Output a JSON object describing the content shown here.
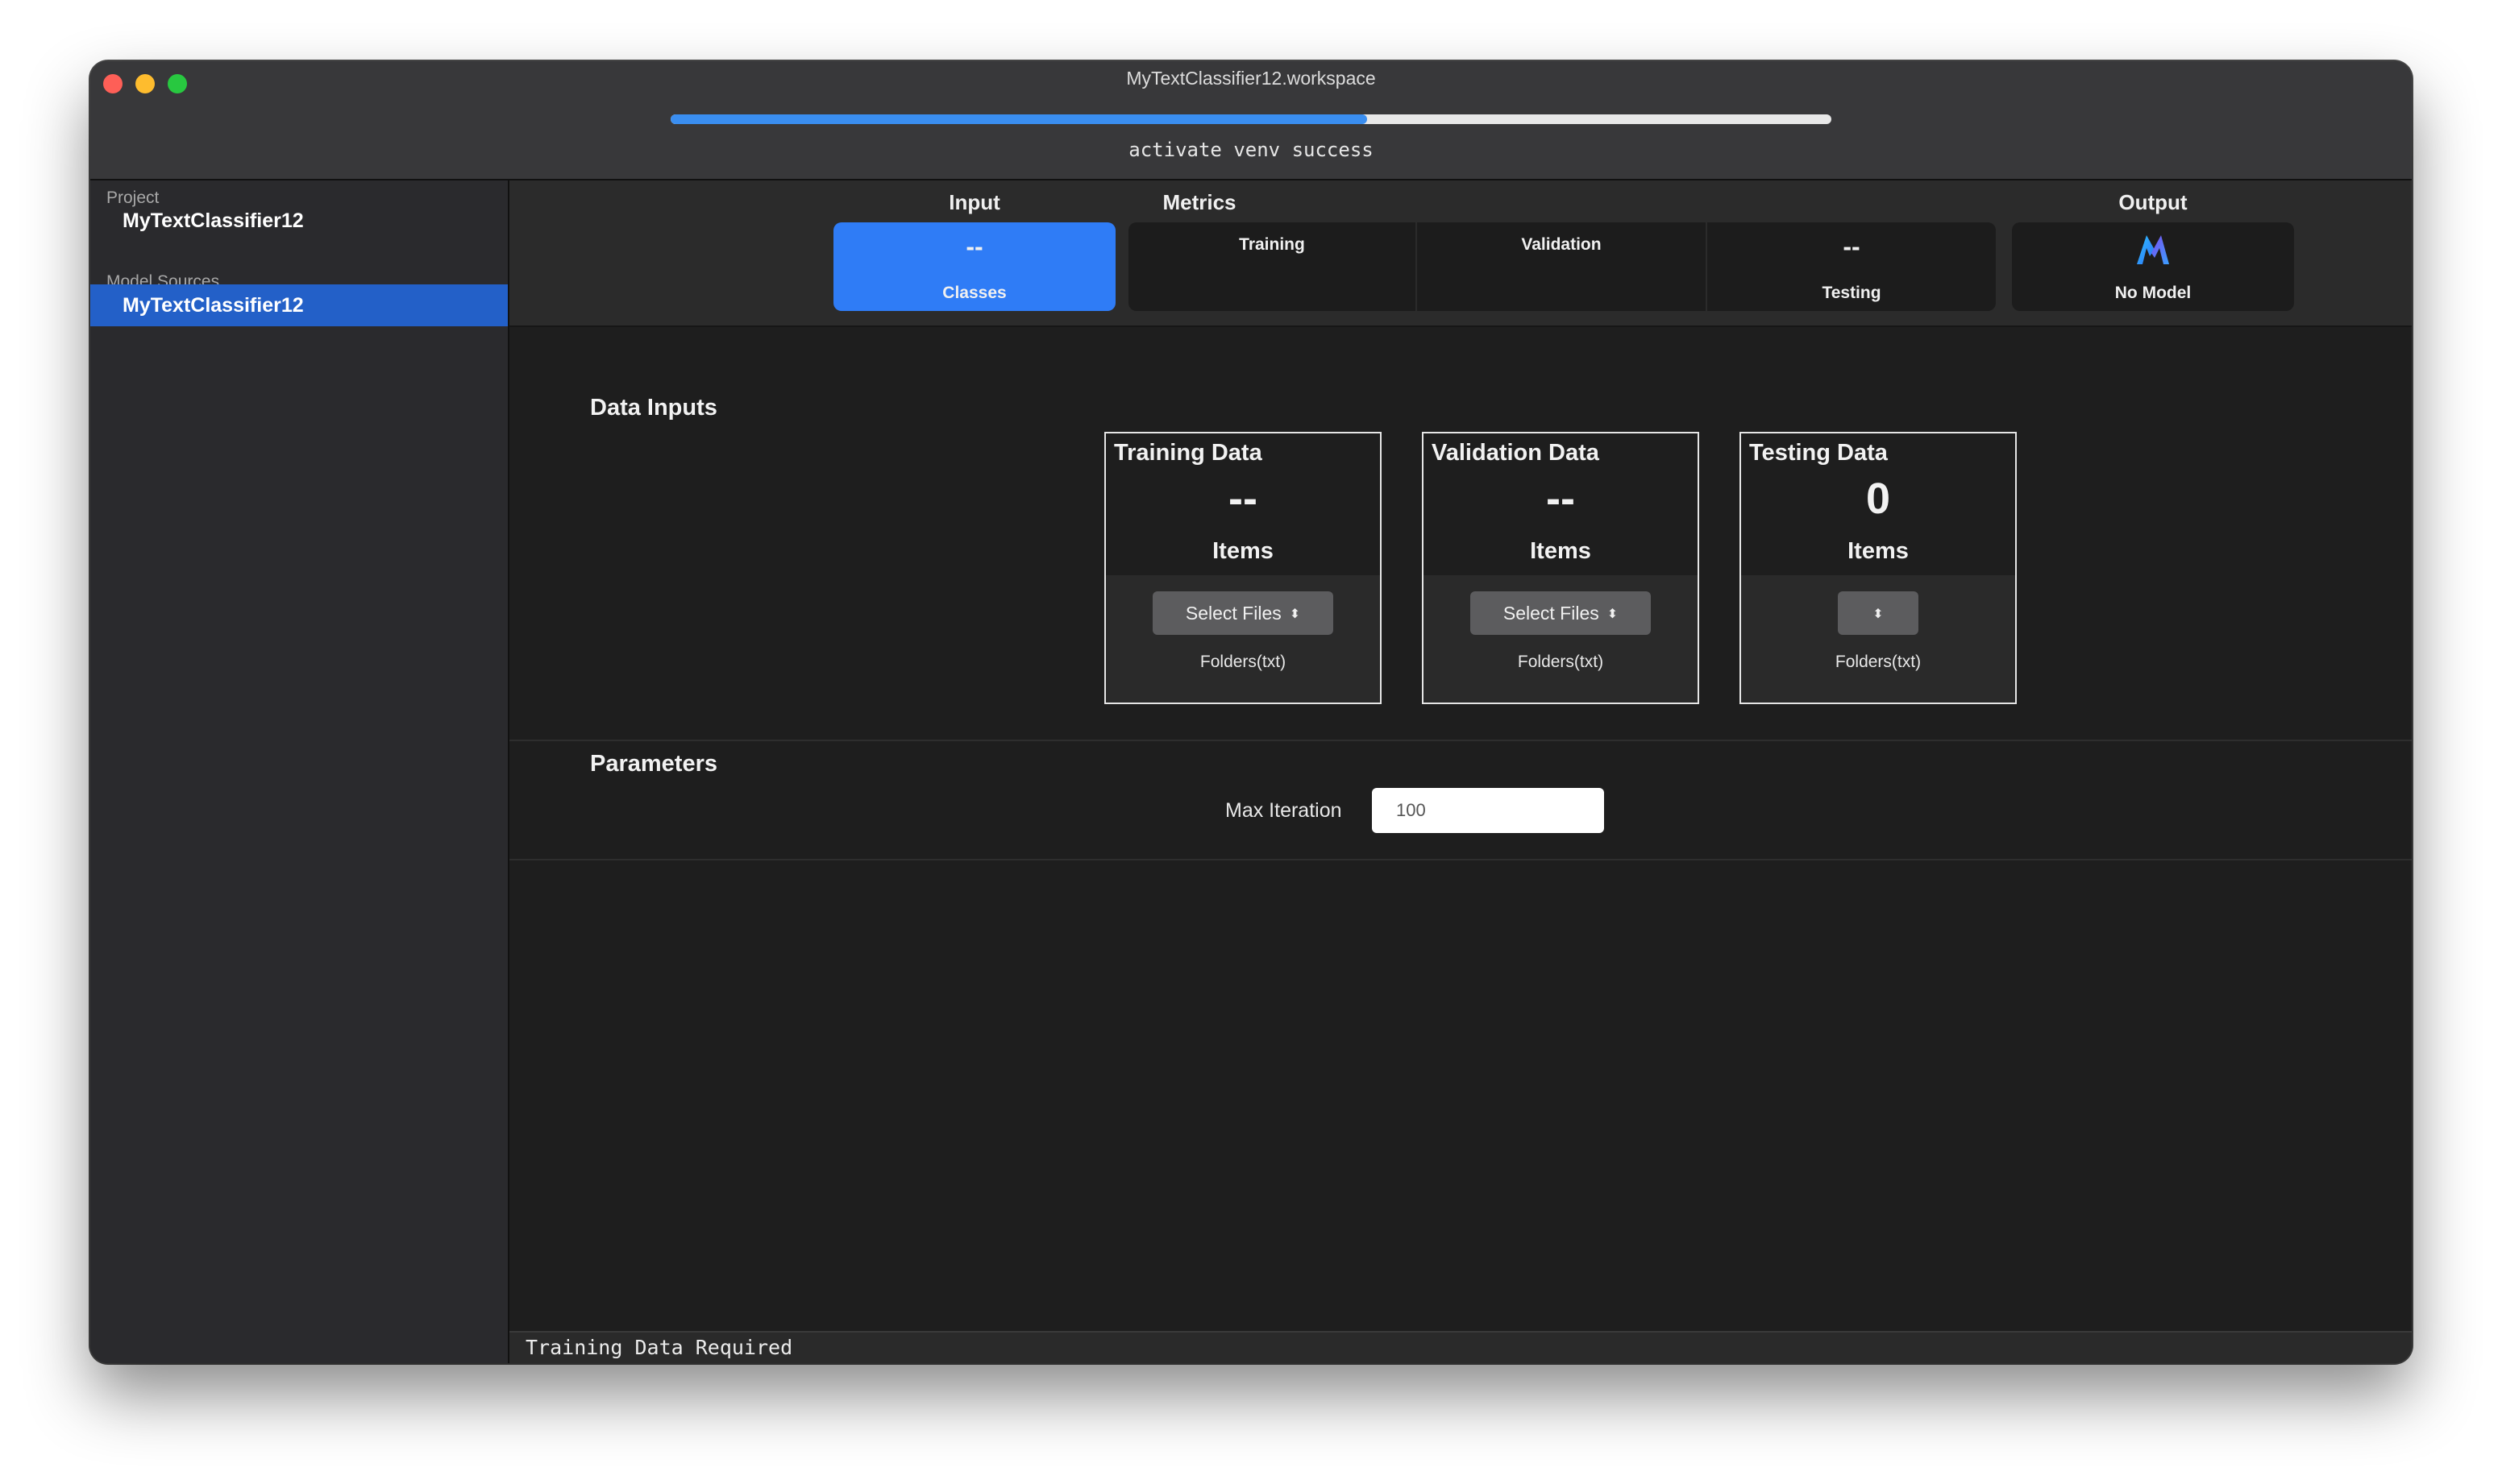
{
  "window": {
    "title": "MyTextClassifier12.workspace",
    "progress": 0.6,
    "status_message": "activate venv success"
  },
  "sidebar": {
    "sections": [
      {
        "label": "Project",
        "items": [
          "MyTextClassifier12"
        ]
      },
      {
        "label": "Model Sources",
        "items": [
          "MyTextClassifier12"
        ]
      }
    ],
    "selected_item": "MyTextClassifier12"
  },
  "tabs": {
    "input": {
      "heading": "Input",
      "value": "--",
      "label": "Classes"
    },
    "metrics": {
      "heading": "Metrics",
      "training_label": "Training",
      "validation_label": "Validation",
      "testing_value": "--",
      "testing_label": "Testing"
    },
    "output": {
      "heading": "Output",
      "icon": "create-ml-logo-icon",
      "label": "No Model"
    }
  },
  "data_inputs": {
    "title": "Data Inputs",
    "cards": [
      {
        "title": "Training Data",
        "count": "--",
        "unit": "Items",
        "button": "Select Files",
        "hint": "Folders(txt)"
      },
      {
        "title": "Validation Data",
        "count": "--",
        "unit": "Items",
        "button": "Select Files",
        "hint": "Folders(txt)"
      },
      {
        "title": "Testing Data",
        "count": "0",
        "unit": "Items",
        "button": "",
        "hint": "Folders(txt)"
      }
    ]
  },
  "parameters": {
    "title": "Parameters",
    "max_iteration_label": "Max Iteration",
    "max_iteration_value": "100"
  },
  "footer": {
    "message": "Training Data Required"
  },
  "colors": {
    "accent": "#2f7cf6",
    "sidebar_selected": "#2360c8",
    "progress": "#3a8ef0"
  }
}
